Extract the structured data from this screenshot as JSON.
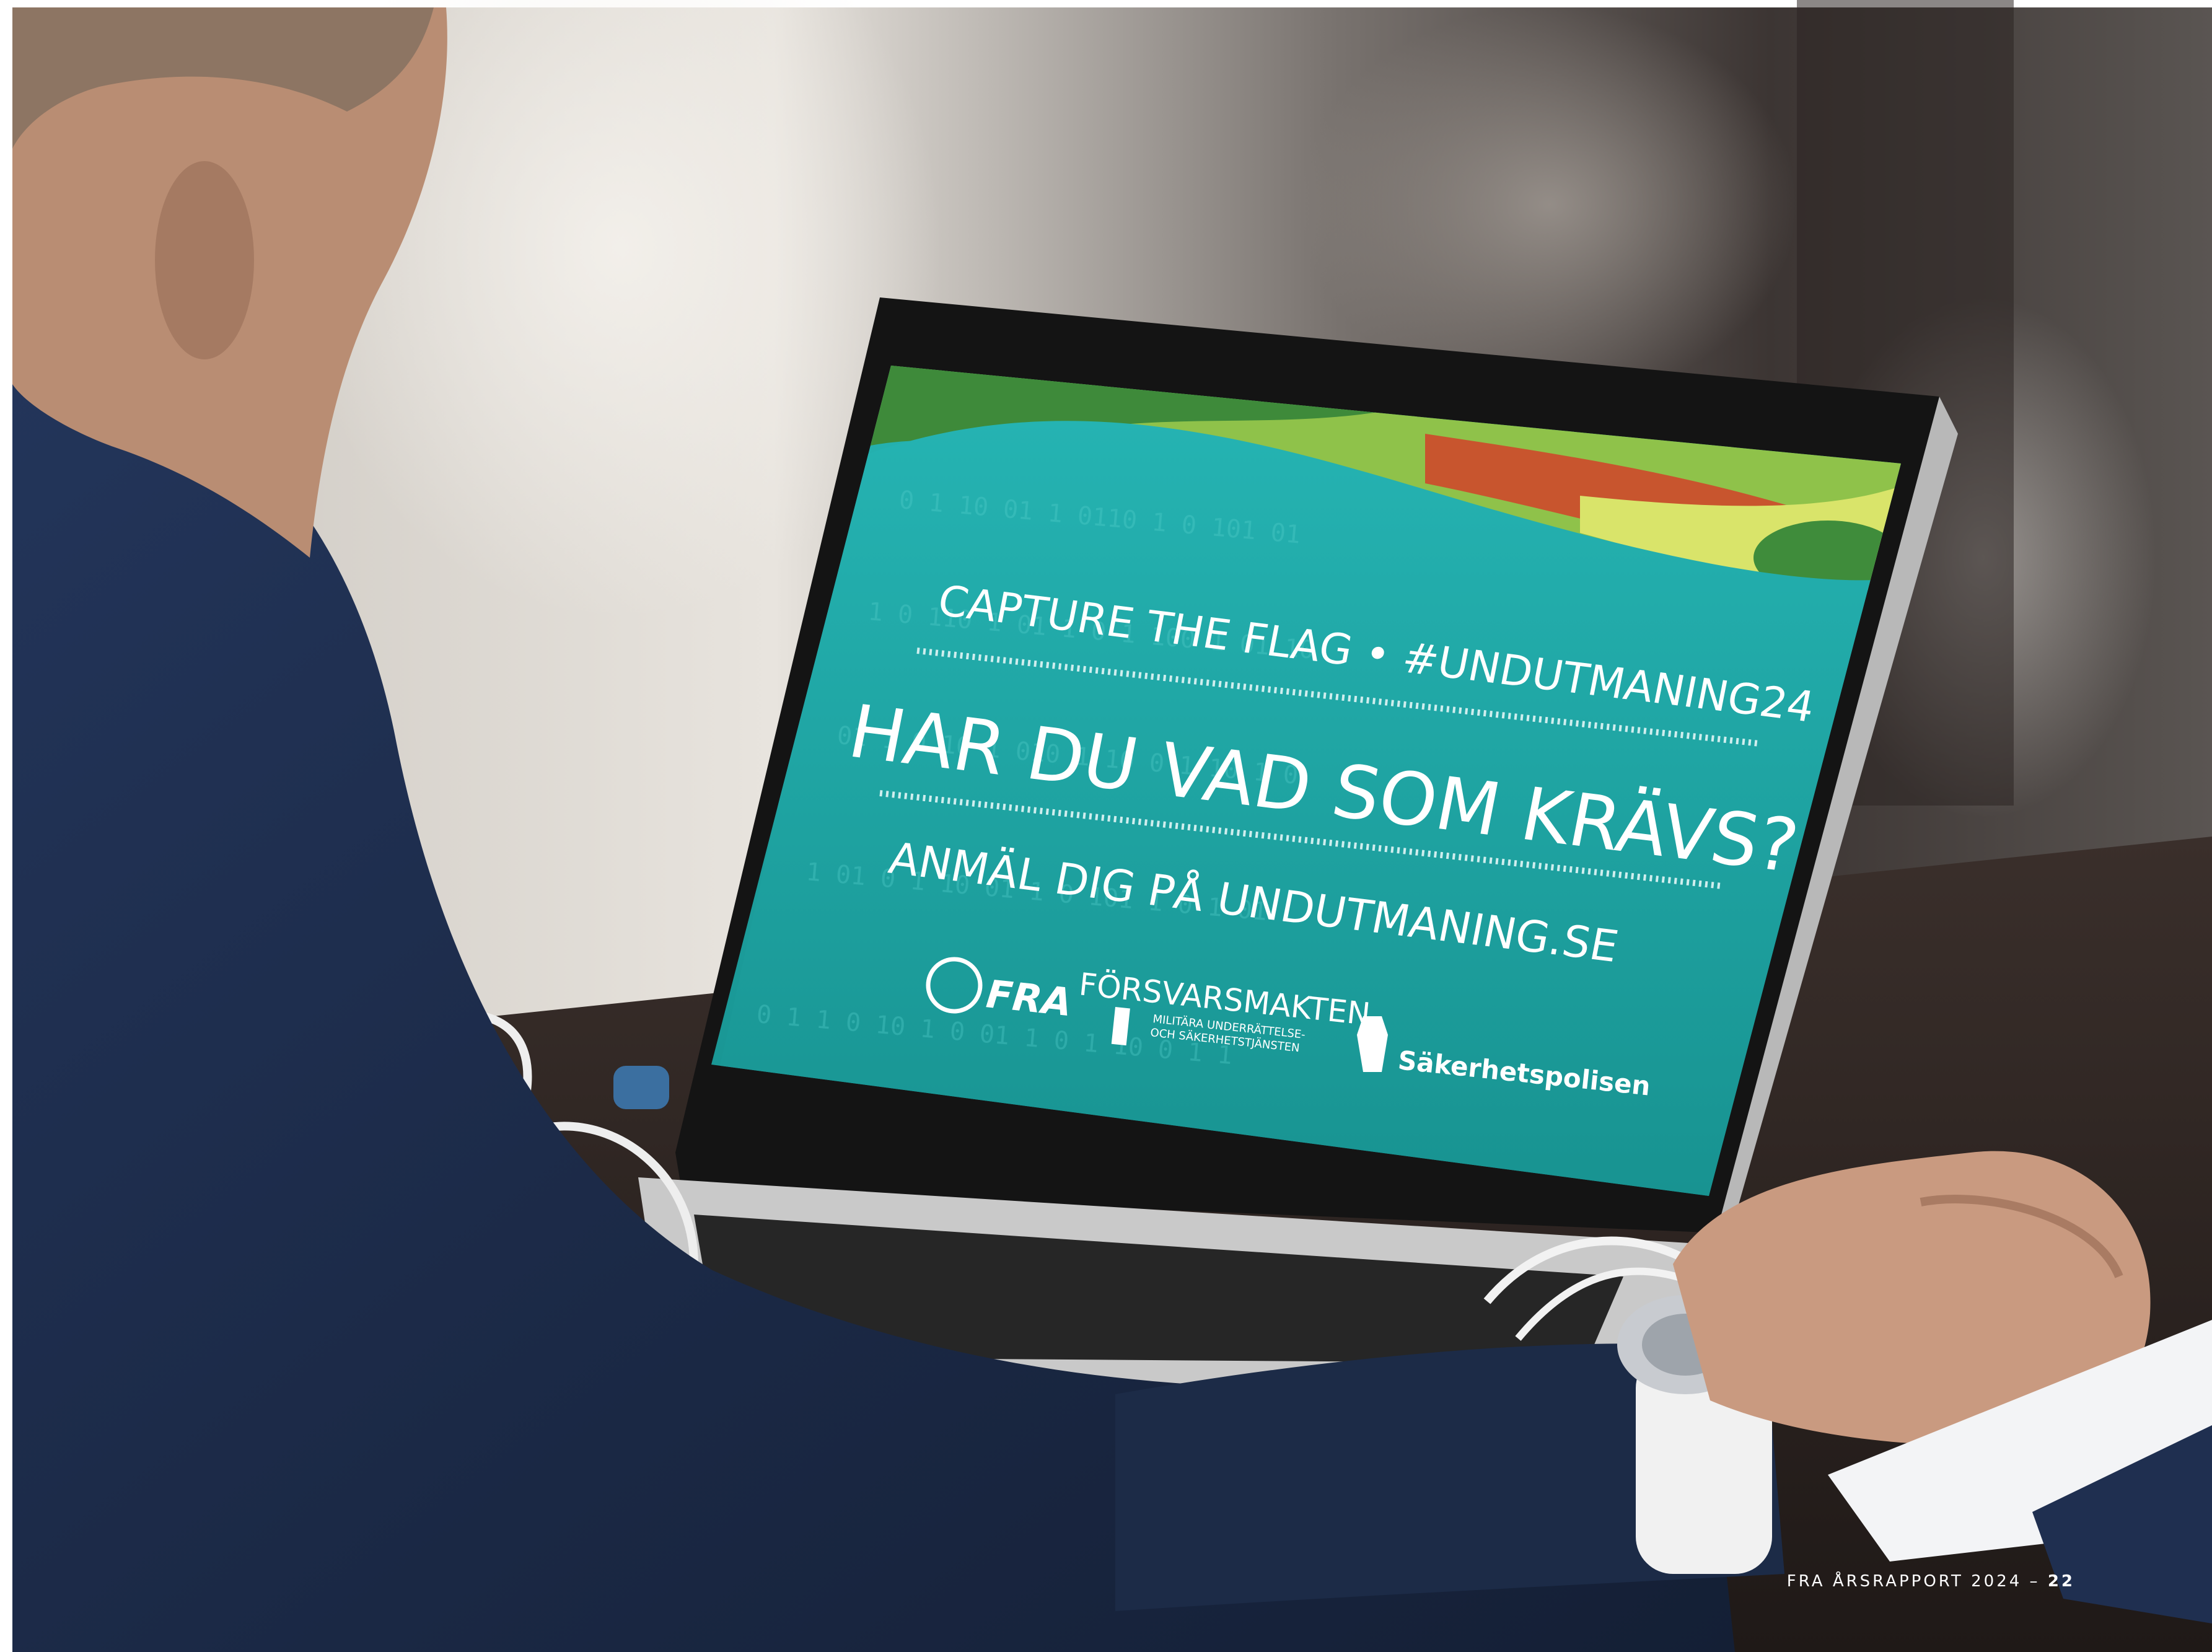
{
  "screen": {
    "headline_small": "CAPTURE THE FLAG • #UNDUTMANING24",
    "headline_main": "HAR DU VAD SOM KRÄVS?",
    "cta": "ANMÄL DIG PÅ UNDUTMANING.SE",
    "logos": {
      "fra": "FRA",
      "forsvarsmakten": "FÖRSVARSMAKTEN",
      "forsvarsmakten_sub_1": "MILITÄRA UNDERRÄTTELSE-",
      "forsvarsmakten_sub_2": "OCH SÄKERHETSTJÄNSTEN",
      "sapo": "Säkerhetspolisen"
    }
  },
  "footer": {
    "report": "FRA ÅRSRAPPORT 2024 –",
    "page": "22"
  },
  "colors": {
    "screen_teal": "#1fa5a6",
    "jacket_navy": "#1b2a44",
    "landscape_green": "#8fc24a"
  }
}
